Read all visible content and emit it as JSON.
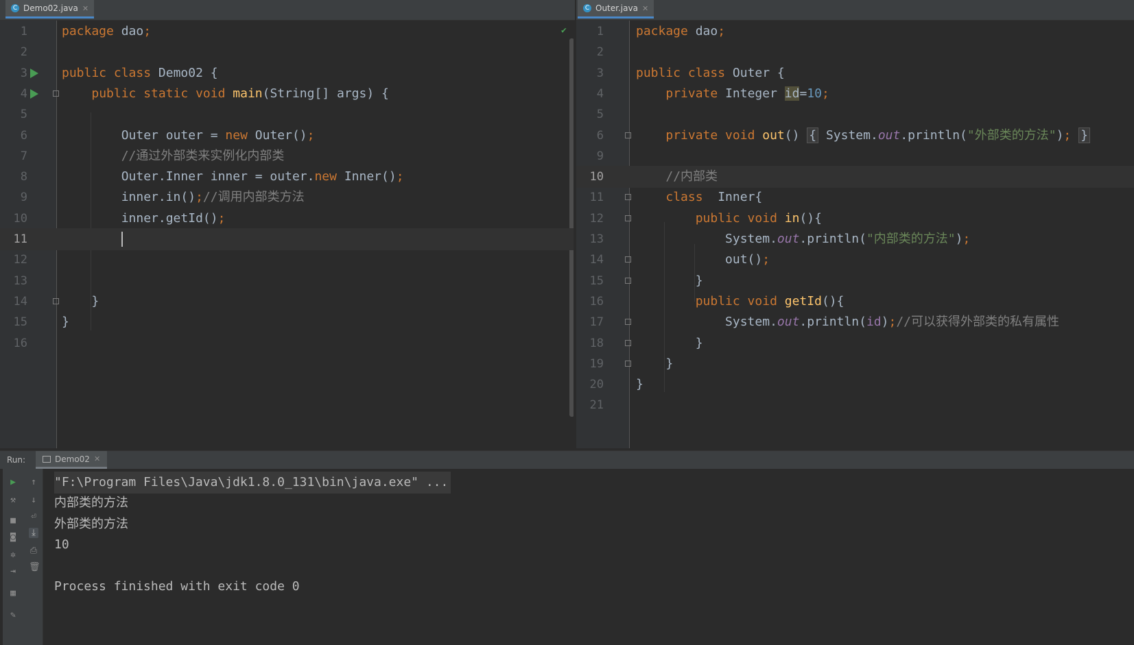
{
  "left_editor": {
    "tab": {
      "label": "Demo02.java"
    },
    "lines": [
      {
        "n": "1",
        "tokens": [
          [
            "kw",
            "package"
          ],
          [
            "p",
            " dao"
          ],
          [
            "kw",
            ";"
          ]
        ]
      },
      {
        "n": "2",
        "tokens": []
      },
      {
        "n": "3",
        "tokens": [
          [
            "kw",
            "public class "
          ],
          [
            "p",
            "Demo02 {"
          ]
        ]
      },
      {
        "n": "4",
        "tokens": [
          [
            "p",
            "    "
          ],
          [
            "kw",
            "public static void "
          ],
          [
            "fn",
            "main"
          ],
          [
            "p",
            "(String[] args) {"
          ]
        ]
      },
      {
        "n": "5",
        "tokens": []
      },
      {
        "n": "6",
        "tokens": [
          [
            "p",
            "        Outer outer = "
          ],
          [
            "kw",
            "new "
          ],
          [
            "p",
            "Outer()"
          ],
          [
            "kw",
            ";"
          ]
        ]
      },
      {
        "n": "7",
        "tokens": [
          [
            "p",
            "        "
          ],
          [
            "cm",
            "//通过外部类来实例化内部类"
          ]
        ]
      },
      {
        "n": "8",
        "tokens": [
          [
            "p",
            "        Outer.Inner inner = outer."
          ],
          [
            "kw",
            "new "
          ],
          [
            "p",
            "Inner()"
          ],
          [
            "kw",
            ";"
          ]
        ]
      },
      {
        "n": "9",
        "tokens": [
          [
            "p",
            "        inner.in()"
          ],
          [
            "kw",
            ";"
          ],
          [
            "cm",
            "//调用内部类方法"
          ]
        ]
      },
      {
        "n": "10",
        "tokens": [
          [
            "p",
            "        inner.getId()"
          ],
          [
            "kw",
            ";"
          ]
        ]
      },
      {
        "n": "11",
        "tokens": [
          [
            "p",
            "        "
          ],
          [
            "caret",
            ""
          ]
        ]
      },
      {
        "n": "12",
        "tokens": []
      },
      {
        "n": "13",
        "tokens": []
      },
      {
        "n": "14",
        "tokens": [
          [
            "p",
            "    }"
          ]
        ]
      },
      {
        "n": "15",
        "tokens": [
          [
            "p",
            "}"
          ]
        ]
      },
      {
        "n": "16",
        "tokens": []
      }
    ]
  },
  "right_editor": {
    "tab": {
      "label": "Outer.java"
    },
    "lines": [
      {
        "n": "1",
        "tokens": [
          [
            "kw",
            "package"
          ],
          [
            "p",
            " dao"
          ],
          [
            "kw",
            ";"
          ]
        ]
      },
      {
        "n": "2",
        "tokens": []
      },
      {
        "n": "3",
        "tokens": [
          [
            "kw",
            "public class "
          ],
          [
            "p",
            "Outer {"
          ]
        ]
      },
      {
        "n": "4",
        "tokens": [
          [
            "p",
            "    "
          ],
          [
            "kw",
            "private "
          ],
          [
            "p",
            "Integer "
          ],
          [
            "hl",
            "id"
          ],
          [
            "p",
            "="
          ],
          [
            "num",
            "10"
          ],
          [
            "kw",
            ";"
          ]
        ]
      },
      {
        "n": "5",
        "tokens": []
      },
      {
        "n": "6",
        "tokens": [
          [
            "p",
            "    "
          ],
          [
            "kw",
            "private void "
          ],
          [
            "fn",
            "out"
          ],
          [
            "p",
            "() "
          ],
          [
            "box",
            "{"
          ],
          [
            "p",
            " System."
          ],
          [
            "st",
            "out"
          ],
          [
            "p",
            ".println("
          ],
          [
            "str",
            "\"外部类的方法\""
          ],
          [
            "p",
            ")"
          ],
          [
            "kw",
            ";"
          ],
          [
            "p",
            " "
          ],
          [
            "box",
            "}"
          ]
        ]
      },
      {
        "n": "9",
        "tokens": []
      },
      {
        "n": "10",
        "tokens": [
          [
            "p",
            "    "
          ],
          [
            "cm",
            "//内部类"
          ]
        ]
      },
      {
        "n": "11",
        "tokens": [
          [
            "p",
            "    "
          ],
          [
            "kw",
            "class  "
          ],
          [
            "p",
            "Inner{"
          ]
        ]
      },
      {
        "n": "12",
        "tokens": [
          [
            "p",
            "        "
          ],
          [
            "kw",
            "public void "
          ],
          [
            "fn",
            "in"
          ],
          [
            "p",
            "(){"
          ]
        ]
      },
      {
        "n": "13",
        "tokens": [
          [
            "p",
            "            System."
          ],
          [
            "st",
            "out"
          ],
          [
            "p",
            ".println("
          ],
          [
            "str",
            "\"内部类的方法\""
          ],
          [
            "p",
            ")"
          ],
          [
            "kw",
            ";"
          ]
        ]
      },
      {
        "n": "14",
        "tokens": [
          [
            "p",
            "            out()"
          ],
          [
            "kw",
            ";"
          ]
        ]
      },
      {
        "n": "15",
        "tokens": [
          [
            "p",
            "        }"
          ]
        ]
      },
      {
        "n": "16",
        "tokens": [
          [
            "p",
            "        "
          ],
          [
            "kw",
            "public void "
          ],
          [
            "fn",
            "getId"
          ],
          [
            "p",
            "(){"
          ]
        ]
      },
      {
        "n": "17",
        "tokens": [
          [
            "p",
            "            System."
          ],
          [
            "st",
            "out"
          ],
          [
            "p",
            ".println("
          ],
          [
            "fld",
            "id"
          ],
          [
            "p",
            ")"
          ],
          [
            "kw",
            ";"
          ],
          [
            "cm",
            "//可以获得外部类的私有属性"
          ]
        ]
      },
      {
        "n": "18",
        "tokens": [
          [
            "p",
            "        }"
          ]
        ]
      },
      {
        "n": "19",
        "tokens": [
          [
            "p",
            "    }"
          ]
        ]
      },
      {
        "n": "20",
        "tokens": [
          [
            "p",
            "}"
          ]
        ]
      },
      {
        "n": "21",
        "tokens": []
      }
    ]
  },
  "run_panel": {
    "label": "Run:",
    "tab_label": "Demo02",
    "output": [
      "\"F:\\Program Files\\Java\\jdk1.8.0_131\\bin\\java.exe\" ...",
      "内部类的方法",
      "外部类的方法",
      "10",
      "",
      "Process finished with exit code 0"
    ]
  },
  "colors": {
    "keyword": "#cc7832",
    "function": "#ffc66d",
    "string": "#6a8759",
    "number": "#6897bb",
    "comment": "#808080",
    "field": "#9876aa"
  },
  "icons": {
    "run_gutter": "play-icon",
    "file": "java-class-icon",
    "check": "check-icon"
  }
}
